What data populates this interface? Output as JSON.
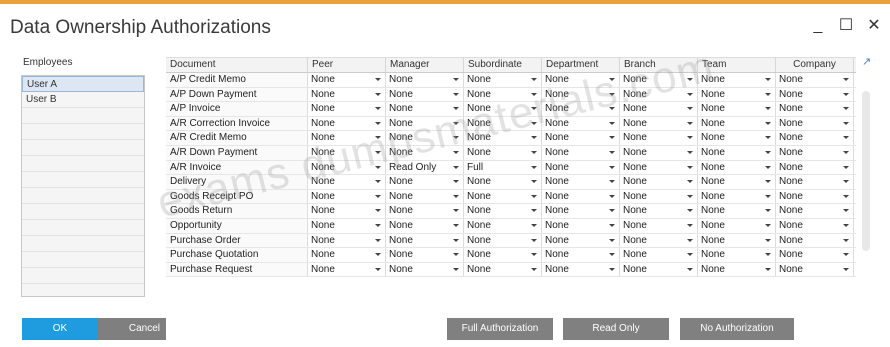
{
  "window": {
    "title": "Data Ownership Authorizations",
    "controls": {
      "minimize": "_",
      "maximize": "☐",
      "close": "✕"
    }
  },
  "employees": {
    "header": "Employees",
    "items": [
      "User A",
      "User B",
      "",
      "",
      "",
      "",
      "",
      "",
      "",
      "",
      "",
      "",
      ""
    ],
    "selected_index": 0
  },
  "grid": {
    "columns": [
      "Document",
      "Peer",
      "Manager",
      "Subordinate",
      "Department",
      "Branch",
      "Team",
      "Company"
    ],
    "rows": [
      {
        "document": "A/P Credit Memo",
        "values": [
          "None",
          "None",
          "None",
          "None",
          "None",
          "None",
          "None"
        ]
      },
      {
        "document": "A/P Down Payment",
        "values": [
          "None",
          "None",
          "None",
          "None",
          "None",
          "None",
          "None"
        ]
      },
      {
        "document": "A/P Invoice",
        "values": [
          "None",
          "None",
          "None",
          "None",
          "None",
          "None",
          "None"
        ]
      },
      {
        "document": "A/R Correction Invoice",
        "values": [
          "None",
          "None",
          "None",
          "None",
          "None",
          "None",
          "None"
        ]
      },
      {
        "document": "A/R Credit Memo",
        "values": [
          "None",
          "None",
          "None",
          "None",
          "None",
          "None",
          "None"
        ]
      },
      {
        "document": "A/R Down Payment",
        "values": [
          "None",
          "None",
          "None",
          "None",
          "None",
          "None",
          "None"
        ]
      },
      {
        "document": "A/R Invoice",
        "values": [
          "None",
          "Read Only",
          "Full",
          "None",
          "None",
          "None",
          "None"
        ]
      },
      {
        "document": "Delivery",
        "values": [
          "None",
          "None",
          "None",
          "None",
          "None",
          "None",
          "None"
        ]
      },
      {
        "document": "Goods Receipt PO",
        "values": [
          "None",
          "None",
          "None",
          "None",
          "None",
          "None",
          "None"
        ]
      },
      {
        "document": "Goods Return",
        "values": [
          "None",
          "None",
          "None",
          "None",
          "None",
          "None",
          "None"
        ]
      },
      {
        "document": "Opportunity",
        "values": [
          "None",
          "None",
          "None",
          "None",
          "None",
          "None",
          "None"
        ]
      },
      {
        "document": "Purchase Order",
        "values": [
          "None",
          "None",
          "None",
          "None",
          "None",
          "None",
          "None"
        ]
      },
      {
        "document": "Purchase Quotation",
        "values": [
          "None",
          "None",
          "None",
          "None",
          "None",
          "None",
          "None"
        ]
      },
      {
        "document": "Purchase Request",
        "values": [
          "None",
          "None",
          "None",
          "None",
          "None",
          "None",
          "None"
        ]
      }
    ]
  },
  "watermark": "exams dumpsmaterials.com",
  "buttons": {
    "ok": "OK",
    "cancel": "Cancel",
    "full_authorization": "Full Authorization",
    "read_only": "Read Only",
    "no_authorization": "No Authorization"
  },
  "colors": {
    "accent": "#1f9be0",
    "title_bar_accent": "#e9a23a",
    "button_grey": "#808080",
    "selected_row": "#dce7f3"
  }
}
